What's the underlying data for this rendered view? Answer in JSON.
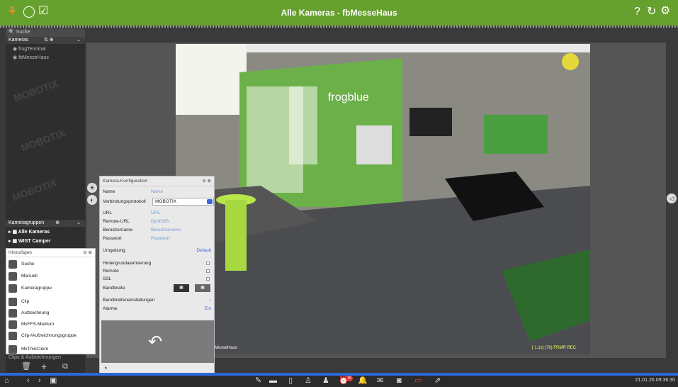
{
  "window": {
    "title": "Alle Kameras - fbMesseHaus"
  },
  "left": {
    "search_placeholder": "Suche",
    "kameras_label": "Kameras",
    "tree": [
      "frogTerminal",
      "fbMesseHaus"
    ],
    "groups_label": "Kameragruppen",
    "groups": [
      "Alle Kameras",
      "WIST Camper"
    ],
    "watermark": "MOBOTIX",
    "clips_label": "Clips & Aufzeichnungen"
  },
  "add_menu": {
    "title": "Hinzufügen",
    "items": [
      "Suche",
      "Manuell",
      "Kameragruppe",
      "Clip",
      "Aufzeichnung",
      "MxFFS-Medium",
      "Clip-/Aufzeichnungsgruppe",
      "MxThinClient"
    ]
  },
  "config": {
    "title": "Kamera-Konfiguration",
    "name_label": "Name",
    "name_placeholder": "Name",
    "protocol_label": "Verbindungsprotokoll",
    "protocol_value": "MOBOTIX",
    "url_label": "URL",
    "url_value": "URL",
    "remote_label": "Remote-URL",
    "remote_value": "DynDNS",
    "user_label": "Benutzername",
    "user_value": "Benutzername",
    "pass_label": "Passwort",
    "pass_value": "Passwort",
    "env_label": "Umgebung",
    "env_value": "Default",
    "bg_alarm_label": "Hintergrundalarmierung",
    "remote_toggle_label": "Remote",
    "ssl_label": "SSL",
    "bandwidth_label": "Bandbreite",
    "bw_settings_label": "Bandbreiteneinstellungen",
    "alarms_label": "Alarme",
    "alarms_value": "Ein"
  },
  "camera": {
    "sign": "frogblue",
    "overlay_label": "fbMesseHaus",
    "timestamp": "[ 1.1s] (76) FRMR REC"
  },
  "status": {
    "datetime": "21.01.26 09:36:30",
    "badge": "28"
  },
  "colors": {
    "brand": "#66a02e",
    "accent": "#2a6ad6"
  }
}
